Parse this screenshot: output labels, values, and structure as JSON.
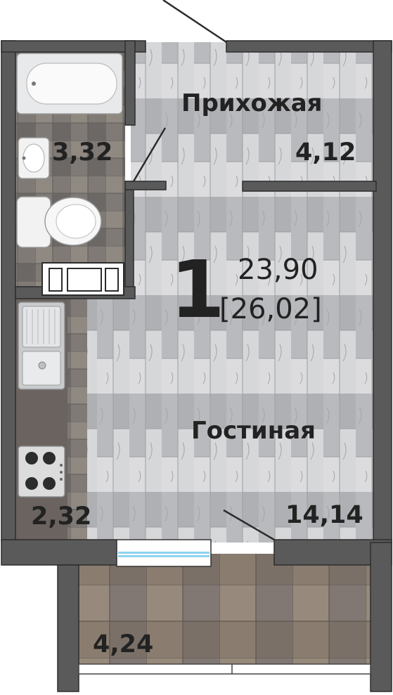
{
  "apartment": {
    "rooms_count": "1",
    "living_area": "23,90",
    "total_area": "[26,02]"
  },
  "rooms": {
    "hallway": {
      "name": "Прихожая",
      "area": "4,12"
    },
    "bathroom": {
      "area": "3,32"
    },
    "living_room": {
      "name": "Гостиная",
      "area": "14,14"
    },
    "kitchen": {
      "area": "2,32"
    },
    "balcony": {
      "area": "4,24"
    }
  },
  "colors": {
    "wall": "#5a5a5a",
    "wall_outline": "#2c2c2c",
    "wood_floor": "#c8c9cb",
    "tile_light": "#8e8a83",
    "tile_dark": "#6f6b68",
    "balcony_tile": "#8d7f70",
    "window_blue": "#8fd3ef",
    "text": "#222222"
  },
  "icons": [
    "bathtub-icon",
    "sink-icon",
    "toilet-icon",
    "kitchen-sink-icon",
    "stove-icon",
    "door-icon"
  ]
}
